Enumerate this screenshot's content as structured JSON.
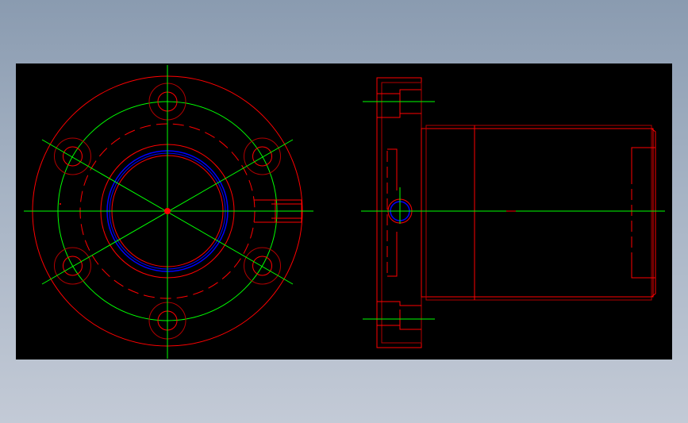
{
  "colors": {
    "background_page": "#9aa7b8",
    "canvas": "#000000",
    "outline": "#ff0000",
    "centerline": "#00ff00",
    "thread": "#0000ff",
    "dark_line": "#b00000"
  },
  "views": [
    {
      "name": "front-view",
      "bolt_hole_count": 6
    },
    {
      "name": "side-view"
    }
  ]
}
